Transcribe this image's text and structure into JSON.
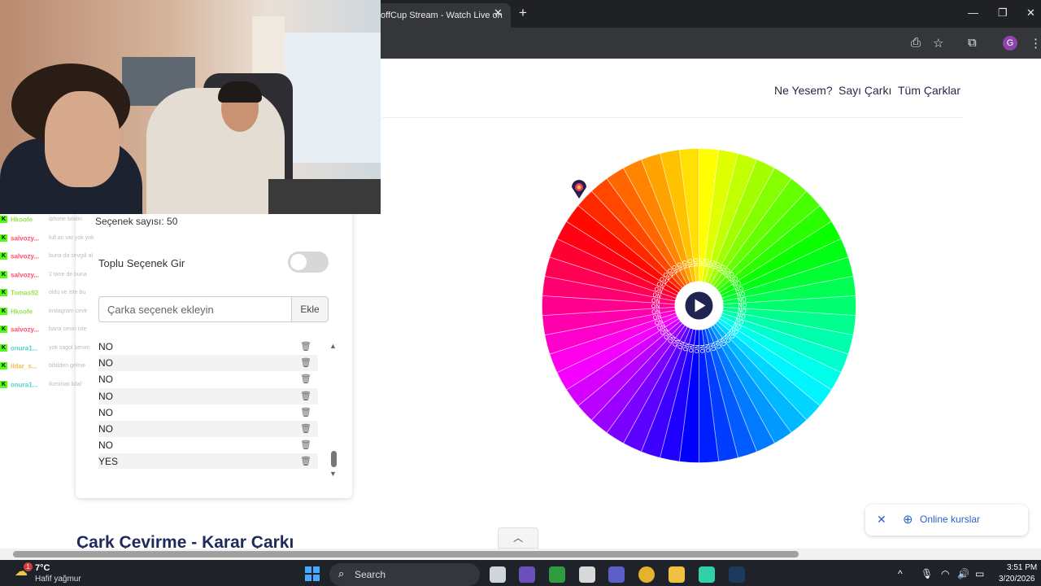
{
  "browser": {
    "tab_title": "offCup Stream - Watch Live on",
    "tab_close": "✕",
    "new_tab": "+",
    "profile_initial": "G",
    "window_controls": [
      "—",
      "❐",
      "✕"
    ]
  },
  "site_nav": {
    "items": [
      "Ne Yesem?",
      "Sayı Çarkı",
      "Tüm Çarklar"
    ]
  },
  "options_panel": {
    "option_count": "Seçenek sayısı: 50",
    "bulk_label": "Toplu Seçenek Gir",
    "bulk_enabled": false,
    "input_placeholder": "Çarka seçenek ekleyin",
    "add_label": "Ekle",
    "visible_options": [
      "NO",
      "NO",
      "NO",
      "NO",
      "NO",
      "NO",
      "NO",
      "YES"
    ]
  },
  "wheel": {
    "segments": 50,
    "segment_label": "NO",
    "play_icon": "play-icon"
  },
  "page": {
    "heading": "Çark Çevirme - Karar Çarkı"
  },
  "toast": {
    "close": "✕",
    "label": "Online kurslar"
  },
  "chat": {
    "messages": [
      {
        "user": "Hkoofe",
        "color": "#9adf53",
        "text": "iphone bilalin"
      },
      {
        "user": "salvozy...",
        "color": "#ff4d6d",
        "text": "full ac var yok yok"
      },
      {
        "user": "salvozy...",
        "color": "#ff4d6d",
        "text": "buna da sevgili al"
      },
      {
        "user": "salvozy...",
        "color": "#ff4d6d",
        "text": "2 tane de buna"
      },
      {
        "user": "Tomas92",
        "color": "#9adf53",
        "text": "oldu ve iste bu"
      },
      {
        "user": "Hkoofe",
        "color": "#9adf53",
        "text": "instagram cevir"
      },
      {
        "user": "salvozy...",
        "color": "#ff4d6d",
        "text": "bana ceviri iste"
      },
      {
        "user": "onura1...",
        "color": "#4fd2c8",
        "text": "yok sagol benim"
      },
      {
        "user": "ildar_s...",
        "color": "#f0c04a",
        "text": "bilalden gelme"
      },
      {
        "user": "onura1...",
        "color": "#4fd2c8",
        "text": "iluminati bilal"
      }
    ]
  },
  "taskbar": {
    "weather_badge": "1",
    "temperature": "7°C",
    "condition": "Hafif yağmur",
    "search_label": "Search",
    "time": "3:51 PM",
    "date": "3/20/2026",
    "tray_up": "^"
  },
  "colors": {
    "nav_text": "#1f2a44",
    "heading": "#1f2a5c",
    "toast_accent": "#2a62c9",
    "kick_green": "#53fc18"
  }
}
